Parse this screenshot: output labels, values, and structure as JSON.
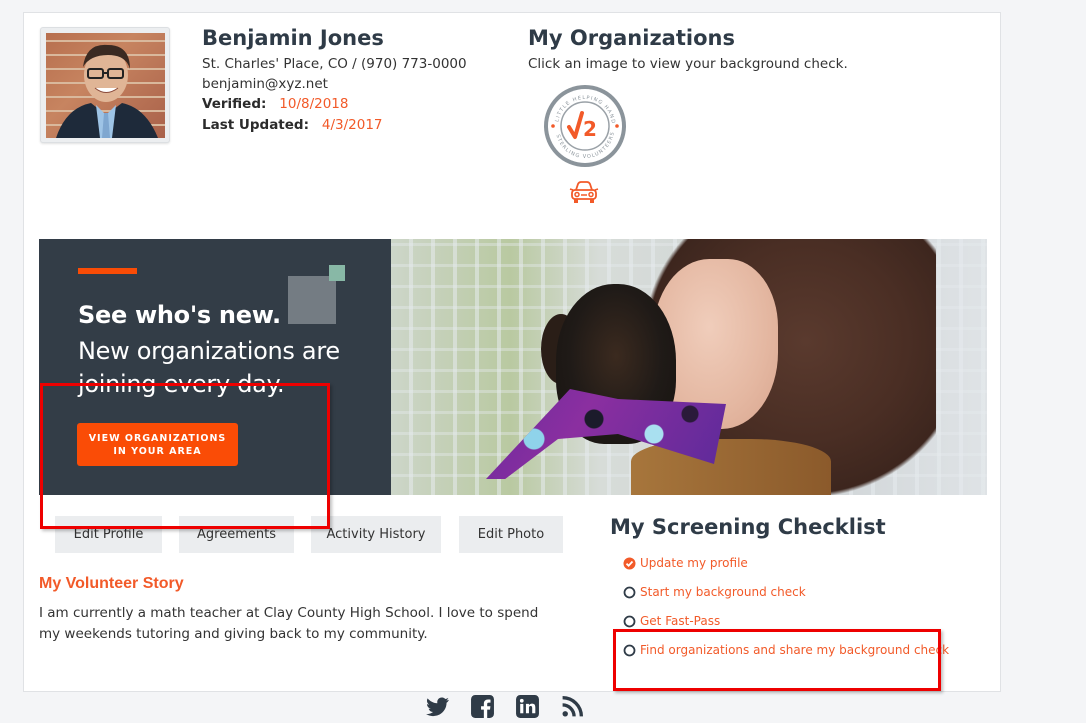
{
  "profile": {
    "name": "Benjamin Jones",
    "location_phone": "St. Charles' Place, CO / (970) 773-0000",
    "email": "benjamin@xyz.net",
    "verified_label": "Verified:",
    "verified_date": "10/8/2018",
    "last_updated_label": "Last Updated:",
    "last_updated_date": "4/3/2017",
    "avatar_icon": "profile-photo"
  },
  "organizations": {
    "title": "My Organizations",
    "subtitle": "Click an image to view your background check.",
    "items": [
      {
        "seal_top_text": "LITTLE HELPING HANDS",
        "seal_bottom_text": "STERLING VOLUNTEERS",
        "seal_center": "√2",
        "icon": "car-icon"
      }
    ]
  },
  "banner": {
    "headline_bold": "See who's new.",
    "headline": "New organizations are joining every day.",
    "button_label": "VIEW ORGANIZATIONS IN YOUR AREA"
  },
  "actions": [
    {
      "label": "Edit Profile"
    },
    {
      "label": "Agreements"
    },
    {
      "label": "Activity History"
    },
    {
      "label": "Edit Photo"
    }
  ],
  "story": {
    "title": "My Volunteer Story",
    "text": "I am currently a math teacher at Clay County High School. I love to spend my weekends tutoring and giving back to my community."
  },
  "checklist": {
    "title": "My Screening Checklist",
    "items": [
      {
        "label": "Update my profile",
        "done": true
      },
      {
        "label": "Start my background check",
        "done": false
      },
      {
        "label": "Get Fast-Pass",
        "done": false
      },
      {
        "label": "Find organizations and share my background check",
        "done": false
      }
    ]
  },
  "social": [
    "twitter-icon",
    "facebook-icon",
    "linkedin-icon",
    "rss-icon"
  ],
  "colors": {
    "accent": "#f25a29",
    "banner_orange": "#fa4c06",
    "banner_dark": "#333d47",
    "heading": "#2f3b47",
    "annotation_red": "#ee0000"
  }
}
